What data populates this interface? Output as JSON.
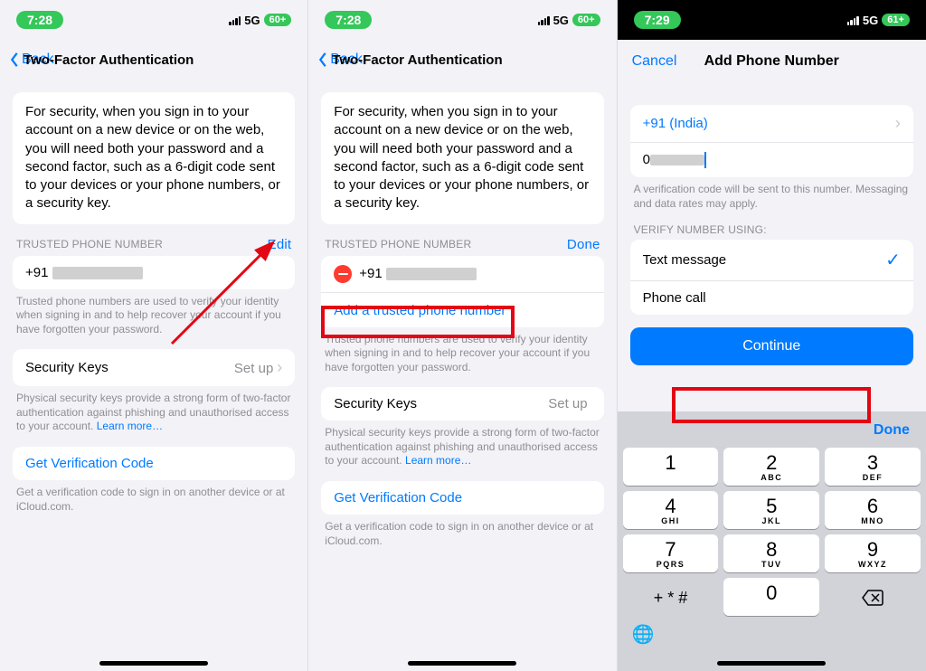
{
  "screens": {
    "a": {
      "time": "7:28",
      "net": "5G",
      "battery": "60+",
      "back": "Back",
      "title": "Two-Factor Authentication",
      "intro": "For security, when you sign in to your account on a new device or on the web, you will need both your password and a second factor, such as a 6-digit code sent to your devices or your phone numbers, or a security key.",
      "trusted_header": "TRUSTED PHONE NUMBER",
      "trusted_action": "Edit",
      "number_prefix": "+91",
      "trusted_footer": "Trusted phone numbers are used to verify your identity when signing in and to help recover your account if you have forgotten your password.",
      "security_keys": "Security Keys",
      "setup": "Set up",
      "security_footer": "Physical security keys provide a strong form of two-factor authentication against phishing and unauthorised access to your account. ",
      "learn_more": "Learn more…",
      "get_code": "Get Verification Code",
      "get_code_footer": "Get a verification code to sign in on another device or at iCloud.com."
    },
    "b": {
      "time": "7:28",
      "net": "5G",
      "battery": "60+",
      "back": "Back",
      "title": "Two-Factor Authentication",
      "intro": "For security, when you sign in to your account on a new device or on the web, you will need both your password and a second factor, such as a 6-digit code sent to your devices or your phone numbers, or a security key.",
      "trusted_header": "TRUSTED PHONE NUMBER",
      "trusted_action": "Done",
      "number_prefix": "+91",
      "add_link": "Add a trusted phone number",
      "trusted_footer": "Trusted phone numbers are used to verify your identity when signing in and to help recover your account if you have forgotten your password.",
      "security_keys": "Security Keys",
      "setup": "Set up",
      "security_footer": "Physical security keys provide a strong form of two-factor authentication against phishing and unauthorised access to your account. ",
      "learn_more": "Learn more…",
      "get_code": "Get Verification Code",
      "get_code_footer": "Get a verification code to sign in on another device or at iCloud.com."
    },
    "c": {
      "time": "7:29",
      "net": "5G",
      "battery": "61+",
      "cancel": "Cancel",
      "title": "Add Phone Number",
      "country": "+91 (India)",
      "input_value": "0",
      "verify_footer": "A verification code will be sent to this number. Messaging and data rates may apply.",
      "verify_header": "VERIFY NUMBER USING:",
      "opt_text": "Text message",
      "opt_call": "Phone call",
      "continue": "Continue",
      "done": "Done",
      "keys": [
        {
          "d": "1",
          "l": ""
        },
        {
          "d": "2",
          "l": "ABC"
        },
        {
          "d": "3",
          "l": "DEF"
        },
        {
          "d": "4",
          "l": "GHI"
        },
        {
          "d": "5",
          "l": "JKL"
        },
        {
          "d": "6",
          "l": "MNO"
        },
        {
          "d": "7",
          "l": "PQRS"
        },
        {
          "d": "8",
          "l": "TUV"
        },
        {
          "d": "9",
          "l": "WXYZ"
        }
      ],
      "symbols": "+ * #",
      "zero": "0"
    }
  }
}
